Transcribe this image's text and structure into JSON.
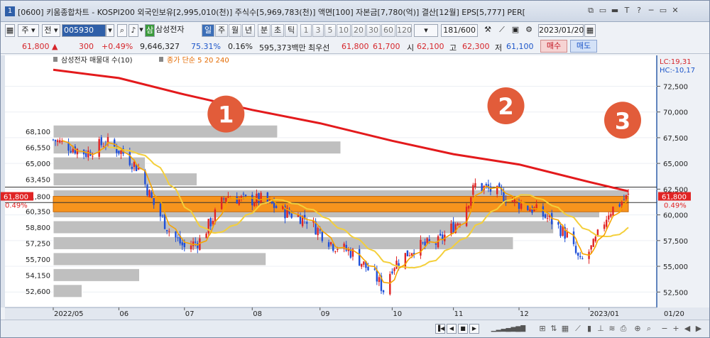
{
  "window": {
    "number_badge": "1",
    "title": "[0600] 키움종합차트 - KOSPI200 외국인보유[2,995,010(천)] 주식수[5,969,783(천)] 액면[100] 자본금[7,780(억)] 결산[12월] EPS[5,777] PER[",
    "title_icons": [
      "⧉",
      "▭",
      "▬",
      "T",
      "?",
      "─",
      "▭",
      "✕"
    ]
  },
  "toolbar": {
    "period_select": "주",
    "market_select": "전",
    "code_input": "005930",
    "stock_badge": "삼",
    "stock_name": "삼성전자",
    "period_buttons": [
      "일",
      "주",
      "월",
      "년",
      "분",
      "초",
      "틱"
    ],
    "active_period": "일",
    "interval_buttons": [
      "1",
      "3",
      "5",
      "10",
      "20",
      "30",
      "60",
      "120"
    ],
    "count_value": "181",
    "count_total": "/600",
    "date_value": "2023/01/20"
  },
  "quote": {
    "price": "61,800",
    "change_arrow": "▲",
    "change": "300",
    "change_pct": "+0.49%",
    "volume": "9,646,327",
    "vol_ratio": "75.31%",
    "turnover": "0.16%",
    "amount": "595,373백만",
    "best_label": "최우선",
    "best_ask": "61,800",
    "best_bid": "61,700",
    "open_label": "시",
    "open": "62,100",
    "high_label": "고",
    "high": "62,300",
    "low_label": "저",
    "low": "61,100",
    "buy_button": "매수",
    "sell_button": "매도"
  },
  "chart_labels": {
    "legend_volume_profile": "삼성전자 매물대 수(10)",
    "legend_ma": "종가 단순 5 20 240",
    "lc": "LC:19,31",
    "hc": "HC:-10,17",
    "price_tag": "61,800",
    "pct_tag": "0.49%",
    "left_tag_price": "61,800",
    "left_tag_pct": "0.49%",
    "markers": [
      "1",
      "2",
      "3"
    ],
    "x_axis_end": "01/20"
  },
  "chart_data": {
    "type": "candlestick",
    "x_labels": [
      "2022/05",
      "06",
      "07",
      "08",
      "09",
      "10",
      "11",
      "12",
      "2023/01"
    ],
    "y_right_ticks": [
      72500,
      70000,
      67500,
      65000,
      62500,
      60000,
      57500,
      55000,
      52500
    ],
    "y_left_ticks": [
      68100,
      66550,
      65000,
      63450,
      61800,
      60350,
      58800,
      57250,
      55700,
      54150,
      52600
    ],
    "ylim": [
      51000,
      75500
    ],
    "last_close": 61800,
    "support_band": [
      60300,
      61800
    ],
    "volume_profile": [
      {
        "price": 68100,
        "weight": 0.39
      },
      {
        "price": 66550,
        "weight": 0.5
      },
      {
        "price": 65000,
        "weight": 0.16
      },
      {
        "price": 63450,
        "weight": 0.25
      },
      {
        "price": 61800,
        "weight": 1.0
      },
      {
        "price": 60350,
        "weight": 0.95
      },
      {
        "price": 58800,
        "weight": 0.87
      },
      {
        "price": 57250,
        "weight": 0.8
      },
      {
        "price": 55700,
        "weight": 0.37
      },
      {
        "price": 54150,
        "weight": 0.15
      },
      {
        "price": 52600,
        "weight": 0.05
      }
    ],
    "ma240": [
      {
        "date": "2022/05/02",
        "value": 74100
      },
      {
        "date": "2022/06/01",
        "value": 73300
      },
      {
        "date": "2022/07/01",
        "value": 71700
      },
      {
        "date": "2022/08/01",
        "value": 70200
      },
      {
        "date": "2022/09/01",
        "value": 68900
      },
      {
        "date": "2022/10/04",
        "value": 67200
      },
      {
        "date": "2022/11/01",
        "value": 65900
      },
      {
        "date": "2022/12/01",
        "value": 64900
      },
      {
        "date": "2023/01/02",
        "value": 63200
      },
      {
        "date": "2023/01/20",
        "value": 62300
      }
    ],
    "markers_dates": [
      "2022/07/20",
      "2022/11/25",
      "2023/01/20"
    ]
  },
  "colors": {
    "up": "#e02424",
    "down": "#1f4fd8",
    "ma5": "#f6a400",
    "ma20": "#f4cf3a",
    "ma240": "#e31a1c",
    "band": "#f7941d",
    "profile": "#bfbfbf",
    "marker": "#e25c3a"
  }
}
